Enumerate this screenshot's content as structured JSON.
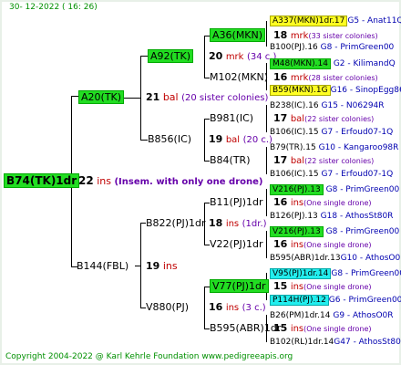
{
  "header": "30- 12-2022 ( 16: 26)",
  "footer": "Copyright 2004-2022 @ Karl Kehrle Foundation    www.pedigreeapis.org",
  "root": {
    "label": "B74(TK)1dr",
    "num": "22",
    "unit": "ins",
    "note": "(Insem. with only one drone)"
  },
  "gen1": [
    {
      "label": "A20(TK)",
      "num": "21",
      "unit": "bal",
      "note": "(20 sister colonies)"
    },
    {
      "label": "B144(FBL)",
      "num": "19",
      "unit": "ins",
      "note": ""
    }
  ],
  "gen2": [
    {
      "label": "A92(TK)",
      "num": "20",
      "unit": "mrk",
      "note": "(34 c.)"
    },
    {
      "label": "B856(IC)",
      "num": "19",
      "unit": "bal",
      "note": "(20 c.)"
    },
    {
      "label": "B822(PJ)1dr",
      "num": "18",
      "unit": "ins",
      "note": "(1dr.)"
    },
    {
      "label": "V880(PJ)",
      "num": "16",
      "unit": "ins",
      "note": "(3 c.)"
    }
  ],
  "gen3": [
    {
      "label": "A36(MKN)",
      "num": "18",
      "unit": "mrk",
      "note": "(33 sister colonies)"
    },
    {
      "label": "M102(MKN)",
      "num": "16",
      "unit": "mrk",
      "note": "(28 sister colonies)"
    },
    {
      "label": "B981(IC)",
      "num": "17",
      "unit": "bal",
      "note": "(22 sister colonies)"
    },
    {
      "label": "B84(TR)",
      "num": "17",
      "unit": "bal",
      "note": "(22 sister colonies)"
    },
    {
      "label": "B11(PJ)1dr",
      "num": "16",
      "unit": "ins",
      "note": "(One single drone)"
    },
    {
      "label": "V22(PJ)1dr",
      "num": "16",
      "unit": "ins",
      "note": "(One single drone)"
    },
    {
      "label": "V77(PJ)1dr",
      "num": "15",
      "unit": "ins",
      "note": "(One single drone)"
    },
    {
      "label": "B595(ABR)1dr",
      "num": "15",
      "unit": "ins",
      "note": "(One single drone)"
    }
  ],
  "gen4": [
    {
      "label": "A337(MKN)1dr.17",
      "note": "G5 - Anat11Q"
    },
    {
      "label": "B100(PJ).16",
      "note": "G8 - PrimGreen00"
    },
    {
      "label": "M48(MKN).14",
      "note": "G2 - KilimandQ"
    },
    {
      "label": "B59(MKN).1G",
      "note": "G16 - SinopEgg86R"
    },
    {
      "label": "B238(IC).16",
      "note": "G15 - N06294R"
    },
    {
      "label": "B106(IC).15",
      "note": "G7 - Erfoud07-1Q"
    },
    {
      "label": "B79(TR).15",
      "note": "G10 - Kangaroo98R"
    },
    {
      "label": "B106(IC).15",
      "note": "G7 - Erfoud07-1Q"
    },
    {
      "label": "V216(PJ).13",
      "note": "G8 - PrimGreen00"
    },
    {
      "label": "B126(PJ).13",
      "note": "G18 - AthosSt80R"
    },
    {
      "label": "V216(PJ).13",
      "note": "G8 - PrimGreen00"
    },
    {
      "label": "B595(ABR)1dr.13",
      "note": "G10 - AthosO0R"
    },
    {
      "label": "V95(PJ)1dr.14",
      "note": "G8 - PrimGreen00"
    },
    {
      "label": "P114H(PJ).12",
      "note": "G6 - PrimGreen00"
    },
    {
      "label": "B26(PM)1dr.14",
      "note": "G9 - AthosO0R"
    },
    {
      "label": "B102(RL)1dr.14",
      "note": "G47 - AthosSt80R"
    }
  ]
}
